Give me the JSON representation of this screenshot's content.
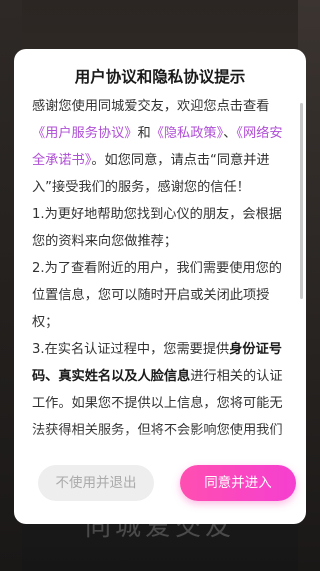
{
  "background": {
    "brand_text": "同城爱交友"
  },
  "dialog": {
    "title": "用户协议和隐私协议提示",
    "intro": {
      "text_1": "感谢您使用同城爱交友，欢迎您点击查看",
      "link_user_agreement": "《用户服务协议》",
      "text_and": "和",
      "link_privacy_policy": "《隐私政策》",
      "text_comma": "、",
      "link_security_pledge": "《网络安全承诺书》",
      "text_2": "。如您同意，请点击“同意并进入”接受我们的服务，感谢您的信任！"
    },
    "item_1": "1.为更好地帮助您找到心仪的朋友，会根据您的资料来向您做推荐；",
    "item_2": "2.为了查看附近的用户，我们需要使用您的位置信息，您可以随时开启或关闭此项授权；",
    "item_3": {
      "text_1": "3.在实名认证过程中，您需要提供",
      "bold": "身份证号码、真实姓名以及人脸信息",
      "text_2": "进行相关的认证工作。如果您不提供以上信息，您将可能无法获得相关服务，但将不会影响您使用我们"
    },
    "decline_button": "不使用并退出",
    "accept_button": "同意并进入"
  },
  "colors": {
    "link": "#b04fd6",
    "accept_gradient_start": "#ff4fb1",
    "accept_gradient_end": "#f53fd0",
    "decline_bg": "#eeeeee",
    "decline_text": "#aaaaaa"
  }
}
